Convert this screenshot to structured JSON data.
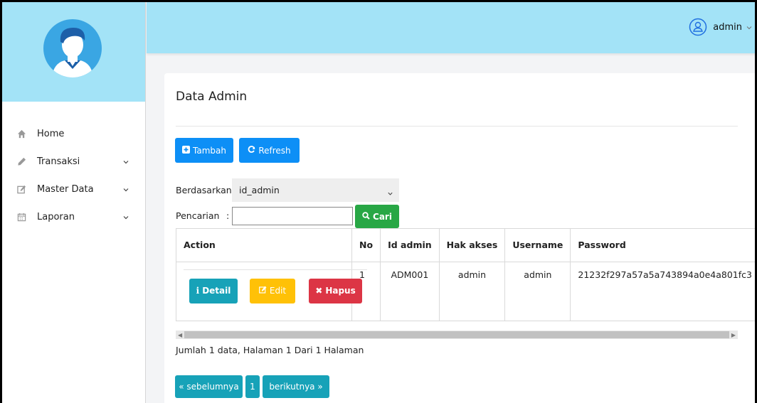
{
  "header": {
    "user_name": "admin",
    "user_icon": "user-circle-icon"
  },
  "sidebar": {
    "avatar_icon": "user-avatar-icon",
    "items": [
      {
        "label": "Home",
        "icon": "home-icon",
        "has_children": false
      },
      {
        "label": "Transaksi",
        "icon": "pencil-icon",
        "has_children": true
      },
      {
        "label": "Master Data",
        "icon": "edit-square-icon",
        "has_children": true
      },
      {
        "label": "Laporan",
        "icon": "calendar-icon",
        "has_children": true
      }
    ]
  },
  "main": {
    "title": "Data Admin",
    "buttons": {
      "add": "Tambah",
      "refresh": "Refresh"
    },
    "filter": {
      "by_label": "Berdasarkan:",
      "by_value": "id_admin",
      "search_label": "Pencarian",
      "search_sep": ":",
      "search_value": "",
      "search_button": "Cari"
    },
    "table": {
      "headers": [
        "Action",
        "No",
        "Id admin",
        "Hak akses",
        "Username",
        "Password"
      ],
      "rows": [
        {
          "no": "1",
          "id": "ADM001",
          "role": "admin",
          "username": "admin",
          "password": "21232f297a57a5a743894a0e4a801fc3"
        }
      ],
      "row_actions": {
        "detail": "Detail",
        "edit": "Edit",
        "delete": "Hapus"
      }
    },
    "summary": "Jumlah 1 data, Halaman 1 Dari 1 Halaman",
    "pagination": {
      "prev": "« sebelumnya",
      "current": "1",
      "next": "berikutnya »"
    }
  },
  "colors": {
    "header_bg": "#a3e3f7",
    "primary": "#0d8ff6",
    "success": "#28a745",
    "info": "#17a2b8",
    "warning": "#ffc107",
    "danger": "#dc3545"
  }
}
